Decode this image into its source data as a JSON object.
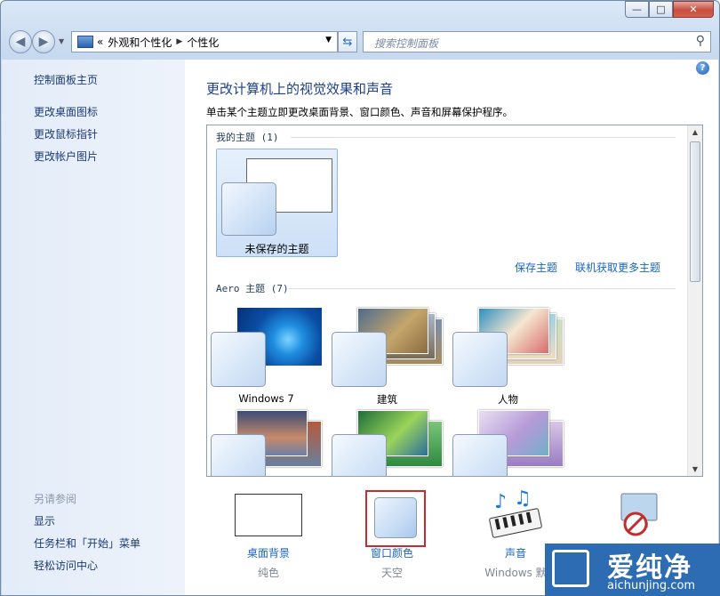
{
  "window": {
    "caption_buttons": [
      "—",
      "□",
      "✕"
    ]
  },
  "nav": {
    "breadcrumb_overflow": "«",
    "crumbs": [
      "外观和个性化",
      "个性化"
    ],
    "search_placeholder": "搜索控制面板"
  },
  "sidebar": {
    "home": "控制面板主页",
    "links": [
      "更改桌面图标",
      "更改鼠标指针",
      "更改帐户图片"
    ],
    "see_also": "另请参阅",
    "see_also_links": [
      "显示",
      "任务栏和「开始」菜单",
      "轻松访问中心"
    ]
  },
  "main": {
    "title": "更改计算机上的视觉效果和声音",
    "description": "单击某个主题立即更改桌面背景、窗口颜色、声音和屏幕保护程序。",
    "my_themes_header": "我的主题 (1)",
    "unsaved_theme": "未保存的主题",
    "save_theme": "保存主题",
    "get_more_themes": "联机获取更多主题",
    "aero_header": "Aero 主题 (7)",
    "themes": [
      "Windows 7",
      "建筑",
      "人物"
    ]
  },
  "bottom": {
    "desktop_background": {
      "label": "桌面背景",
      "value": "纯色"
    },
    "window_color": {
      "label": "窗口颜色",
      "value": "天空"
    },
    "sounds": {
      "label": "声音",
      "value": "Windows 默"
    }
  },
  "watermark": {
    "text": "爱纯净",
    "url": "aichunjing.com"
  },
  "colors": {
    "link": "#1865c6",
    "highlight_border": "#c42d2d"
  }
}
